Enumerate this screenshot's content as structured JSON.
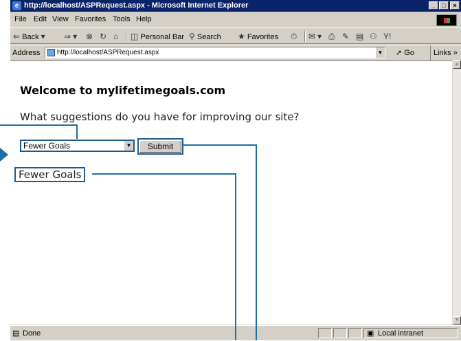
{
  "window": {
    "title": "http://localhost/ASPRequest.aspx - Microsoft Internet Explorer",
    "minimize": "_",
    "maximize": "×",
    "restore": "□"
  },
  "menu": [
    "File",
    "Edit",
    "View",
    "Favorites",
    "Tools",
    "Help"
  ],
  "toolbar": {
    "back": "Back",
    "personal_bar": "Personal Bar",
    "search": "Search",
    "favorites": "Favorites"
  },
  "address": {
    "label": "Address",
    "url": "http://localhost/ASPRequest.aspx",
    "go": "Go",
    "links": "Links"
  },
  "page": {
    "heading": "Welcome to mylifetimegoals.com",
    "question": "What suggestions do you have for improving our site?",
    "select_value": "Fewer Goals",
    "submit_label": "Submit",
    "result": "Fewer Goals"
  },
  "status": {
    "text": "Done",
    "zone": "Local intranet"
  },
  "colors": {
    "titlebar": "#0a246a",
    "callout": "#1a6fa8"
  }
}
